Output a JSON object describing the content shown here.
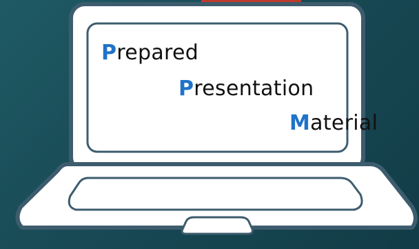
{
  "slide": {
    "background_color": "#1a4c57",
    "accent_color": "#1f73c8",
    "top_tab_color": "#c0392b",
    "laptop_body_color": "#ffffff",
    "laptop_outline_color": "#3d5c6e"
  },
  "screen_text": {
    "line1": {
      "initial": "P",
      "rest": "repared"
    },
    "line2": {
      "initial": "P",
      "rest": "resentation"
    },
    "line3": {
      "initial": "M",
      "rest": "aterial"
    }
  }
}
